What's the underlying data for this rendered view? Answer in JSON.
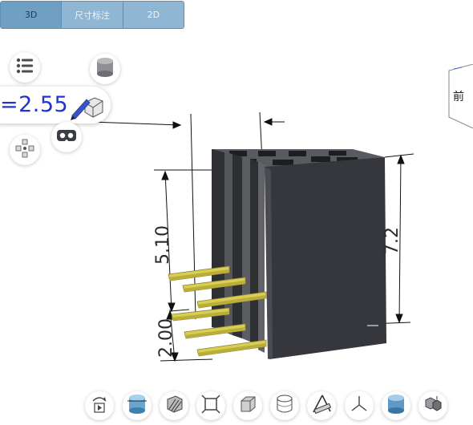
{
  "tabs": [
    {
      "label": "3D",
      "active": true
    },
    {
      "label": "尺寸标注",
      "active": false
    },
    {
      "label": "2D",
      "active": false
    }
  ],
  "measure_readout": "=2.55",
  "viewcube_label": "前",
  "dimensions": {
    "left_upper": "5.10",
    "left_lower": "2.00",
    "right": "7.2"
  },
  "toolbar": [
    {
      "name": "rotate-play-icon"
    },
    {
      "name": "section-view-icon"
    },
    {
      "name": "hatch-cube-icon"
    },
    {
      "name": "fit-view-icon"
    },
    {
      "name": "solid-cube-icon"
    },
    {
      "name": "wireframe-cylinder-icon"
    },
    {
      "name": "measure-angle-icon"
    },
    {
      "name": "axes-icon"
    },
    {
      "name": "material-cylinder-icon"
    },
    {
      "name": "explode-icon"
    }
  ],
  "colors": {
    "tab_active": "#6f9fc3",
    "tab_inactive": "#8fb6d3",
    "housing": "#3a3b40",
    "pin": "#d8cc50",
    "readout": "#2433c8"
  }
}
